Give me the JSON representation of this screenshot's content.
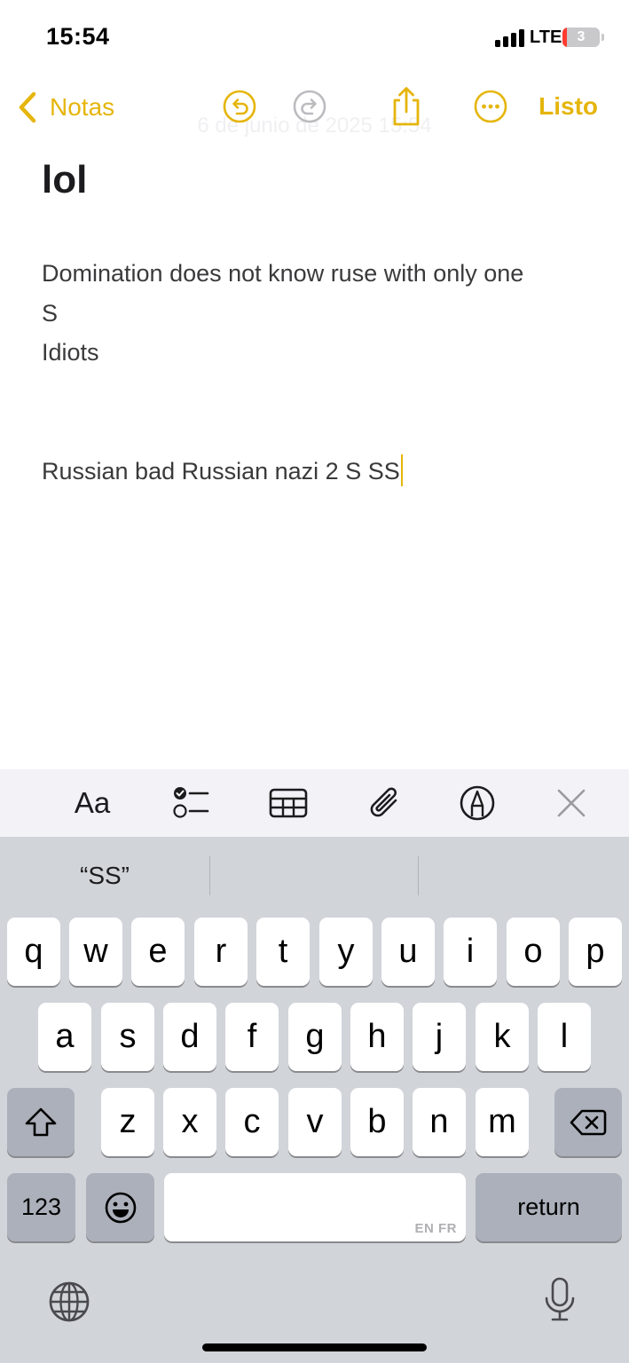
{
  "status_bar": {
    "time": "15:54",
    "network": "LTE",
    "battery_level": "3",
    "battery_fraction": 0.06,
    "battery_low_color": "#ff3b30"
  },
  "nav": {
    "back_label": "Notas",
    "done_label": "Listo",
    "date_text": "6 de junio de 2025 15:54",
    "accent_color": "#e5b50b",
    "icons": [
      "chevron-left-icon",
      "undo-icon",
      "redo-icon",
      "share-icon",
      "more-icon"
    ]
  },
  "note": {
    "title": "lol",
    "lines": [
      "Domination does not know ruse with only one",
      "S",
      "Idiots",
      "",
      "",
      "Russian bad Russian nazi 2 S SS"
    ]
  },
  "format_toolbar": {
    "text_format_label": "Aa",
    "icons": [
      "checklist-icon",
      "table-icon",
      "paperclip-icon",
      "markup-pen-icon",
      "close-icon"
    ]
  },
  "keyboard": {
    "suggestions": [
      "“SS”",
      "",
      ""
    ],
    "rows": [
      [
        "q",
        "w",
        "e",
        "r",
        "t",
        "y",
        "u",
        "i",
        "o",
        "p"
      ],
      [
        "a",
        "s",
        "d",
        "f",
        "g",
        "h",
        "j",
        "k",
        "l"
      ],
      [
        "z",
        "x",
        "c",
        "v",
        "b",
        "n",
        "m"
      ]
    ],
    "numbers_label": "123",
    "return_label": "return",
    "space_languages": "EN FR",
    "icons": [
      "shift-icon",
      "backspace-icon",
      "emoji-icon",
      "globe-icon",
      "microphone-icon"
    ]
  }
}
